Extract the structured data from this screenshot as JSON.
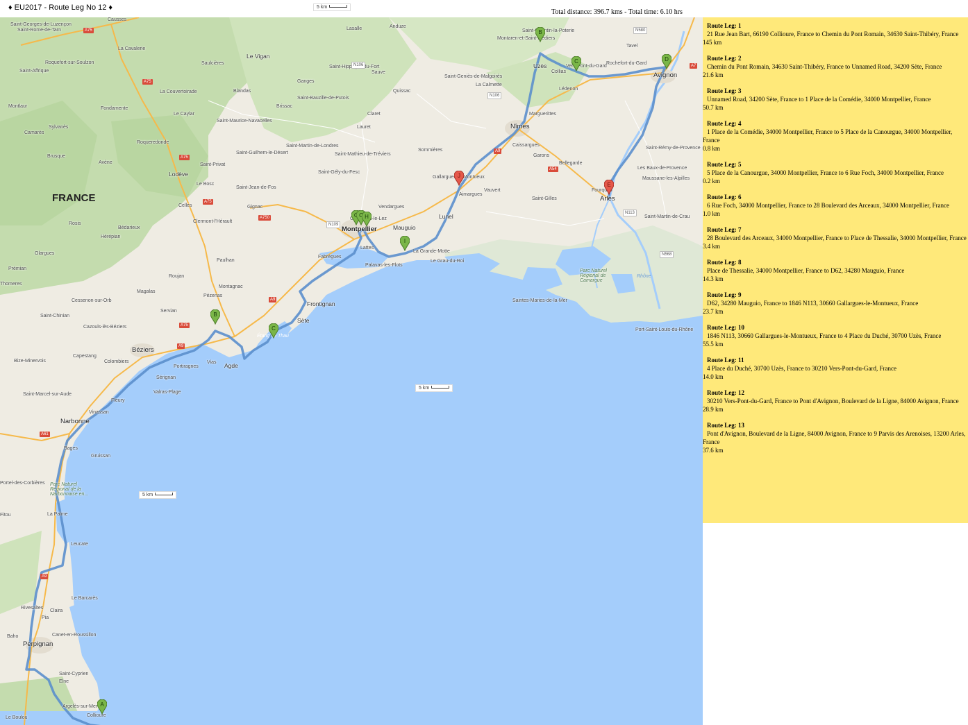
{
  "header": {
    "title": "♦   EU2017 - Route Leg No 12   ♦",
    "totals": "Total distance: 396.7 kms  -  Total time: 6.10 hrs"
  },
  "scale_label": "5 km",
  "map": {
    "country": "FRANCE",
    "places": [
      "Causses",
      "Saint-Georges-de-Luzençon",
      "Saint-Rome-de-Tarn",
      "Saint-Affrique",
      "Roquefort-sur-Soulzon",
      "La Cavalerie",
      "Le Vigan",
      "Saulcières",
      "La Couvertoirade",
      "Montlaur",
      "Fondamente",
      "Le Caylar",
      "Camarès",
      "Sylvanès",
      "Brusque",
      "Roqueredonde",
      "Avène",
      "Saint-Privat",
      "Lodève",
      "Le Bosc",
      "Celles",
      "Clermont-l'Hérault",
      "Rosis",
      "Bédarieux",
      "Hérépian",
      "Olargues",
      "Prémian",
      "Thomeres",
      "Magalas",
      "Cessenon-sur-Orb",
      "Saint-Chinian",
      "Servian",
      "Cazouls-lès-Béziers",
      "Béziers",
      "Bize-Minervois",
      "Capestang",
      "Colombiers",
      "Saint-Marcel-sur-Aude",
      "Narbonne",
      "Fleury",
      "Vinassan",
      "Sérignan",
      "Valras-Plage",
      "Portiragnes",
      "Bages",
      "Gruissan",
      "Portel-des-Corbières",
      "Fitou",
      "La Palme",
      "Leucate",
      "Le Barcarès",
      "Rivesaltes",
      "Claira",
      "Pia",
      "Baho",
      "Perpignan",
      "Canet-en-Roussillon",
      "Saint-Cyprien",
      "Elne",
      "Argelès-sur-Mer",
      "Collioure",
      "Le Boulou",
      "Blandas",
      "Ganges",
      "Brissac",
      "Saint-Maurice-Navacelles",
      "Saint-Martin-de-Londres",
      "Saint-Guilhem-le-Désert",
      "Saint-Jean-de-Fos",
      "Gignac",
      "Saint-Mathieu-de-Tréviers",
      "Saint-Gély-du-Fesc",
      "Saint-Hippolyte-du-Fort",
      "Lasalle",
      "Anduze",
      "Sauve",
      "Quissac",
      "Saint-Bauzille-de-Putois",
      "Claret",
      "Lauret",
      "Sommières",
      "Vendargues",
      "Castelnau-le-Lez",
      "Montpellier",
      "Mauguio",
      "Lattes",
      "Fabrègues",
      "Palavas-les-Flots",
      "La Grande-Motte",
      "Le Grau-du-Roi",
      "Montagnac",
      "Pézenas",
      "Paulhan",
      "Roujan",
      "Vias",
      "Agde",
      "Sète",
      "Frontignan",
      "Lunel",
      "Aimargues",
      "Vauvert",
      "Gallargues-le-Montueux",
      "Saint-Gilles",
      "Nîmes",
      "Caissargues",
      "Garons",
      "Bellegarde",
      "Marguerittes",
      "Saint-Geniès-de-Malgoirès",
      "La Calmette",
      "Uzès",
      "Saint-Quentin-la-Poterie",
      "Montaren-et-Saint-Médiers",
      "Collias",
      "Vers-Pont-du-Gard",
      "Lédenon",
      "Rochefort-du-Gard",
      "Tavel",
      "Avignon",
      "Saint-Rémy-de-Provence",
      "Les Baux-de-Provence",
      "Maussane-les-Alpilles",
      "Fourques",
      "Arles",
      "Saint-Martin-de-Crau",
      "Saintes-Maries-de-la-Mer",
      "Port-Saint-Louis-du-Rhône",
      "Rhône",
      "Étang de Thau",
      "Parc Naturel Régional de Camargue",
      "Parc Naturel Régional de la Narbonnaise en..."
    ],
    "roads": [
      "A75",
      "N106",
      "A750",
      "N109",
      "A9",
      "A61",
      "N113",
      "A54",
      "N580",
      "N568",
      "A7"
    ],
    "markers": [
      {
        "letter": "A",
        "color": "green"
      },
      {
        "letter": "B",
        "color": "green"
      },
      {
        "letter": "C",
        "color": "green"
      },
      {
        "letter": "G",
        "color": "green"
      },
      {
        "letter": "C",
        "color": "green"
      },
      {
        "letter": "H",
        "color": "green"
      },
      {
        "letter": "I",
        "color": "green"
      },
      {
        "letter": "J",
        "color": "red"
      },
      {
        "letter": "B",
        "color": "green"
      },
      {
        "letter": "C",
        "color": "green"
      },
      {
        "letter": "D",
        "color": "green"
      },
      {
        "letter": "E",
        "color": "red"
      }
    ],
    "colors": {
      "sea": "#a4cdfb",
      "land": "#efece3",
      "forest": "#c4dcae",
      "route": "#5b8fcc",
      "marker_green": "#7ab648",
      "marker_red": "#e5584a"
    }
  },
  "legs": [
    {
      "title": "Route Leg: 1",
      "route": "21 Rue Jean Bart, 66190 Collioure, France to Chemin du Pont Romain, 34630 Saint-Thibéry, France",
      "distance": "145 km"
    },
    {
      "title": "Route Leg: 2",
      "route": "Chemin du Pont Romain, 34630 Saint-Thibéry, France to Unnamed Road, 34200 Sète, France",
      "distance": "21.6 km"
    },
    {
      "title": "Route Leg: 3",
      "route": "Unnamed Road, 34200 Sète, France to 1 Place de la Comédie, 34000 Montpellier, France",
      "distance": "50.7 km"
    },
    {
      "title": "Route Leg: 4",
      "route": "1 Place de la Comédie, 34000 Montpellier, France to 5 Place de la Canourgue, 34000 Montpellier, France",
      "distance": "0.8 km"
    },
    {
      "title": "Route Leg: 5",
      "route": "5 Place de la Canourgue, 34000 Montpellier, France to 6 Rue Foch, 34000 Montpellier, France",
      "distance": "0.2 km"
    },
    {
      "title": "Route Leg: 6",
      "route": "6 Rue Foch, 34000 Montpellier, France to 28 Boulevard des Arceaux, 34000 Montpellier, France",
      "distance": "1.0 km"
    },
    {
      "title": "Route Leg: 7",
      "route": "28 Boulevard des Arceaux, 34000 Montpellier, France to Place de Thessalie, 34000 Montpellier, France",
      "distance": "3.4 km"
    },
    {
      "title": "Route Leg: 8",
      "route": "Place de Thessalie, 34000 Montpellier, France to D62, 34280 Mauguio, France",
      "distance": "14.3 km"
    },
    {
      "title": "Route Leg: 9",
      "route": "D62, 34280 Mauguio, France to 1846 N113, 30660 Gallargues-le-Montueux, France",
      "distance": "23.7 km"
    },
    {
      "title": "Route Leg: 10",
      "route": "1846 N113, 30660 Gallargues-le-Montueux, France to 4 Place du Duché, 30700 Uzès, France",
      "distance": "55.5 km"
    },
    {
      "title": "Route Leg: 11",
      "route": "4 Place du Duché, 30700 Uzès, France to 30210 Vers-Pont-du-Gard, France",
      "distance": "14.0 km"
    },
    {
      "title": "Route Leg: 12",
      "route": "30210 Vers-Pont-du-Gard, France to Pont d'Avignon, Boulevard de la Ligne, 84000 Avignon, France",
      "distance": "28.9 km"
    },
    {
      "title": "Route Leg: 13",
      "route": "Pont d'Avignon, Boulevard de la Ligne, 84000 Avignon, France to 9 Parvis des Arenoises, 13200 Arles, France",
      "distance": "37.6 km"
    }
  ]
}
